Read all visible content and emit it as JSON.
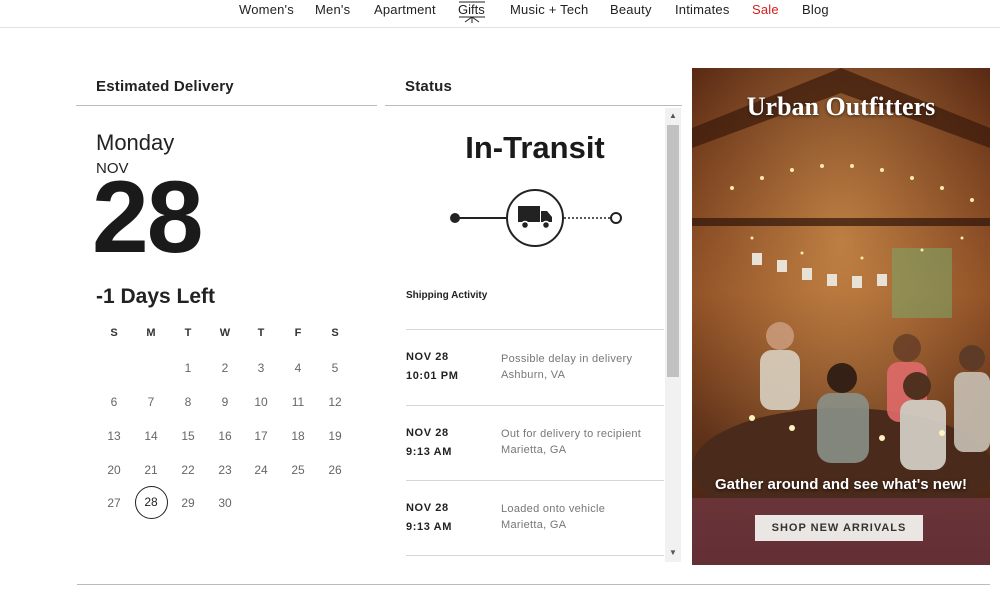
{
  "nav": {
    "items": [
      "Women's",
      "Men's",
      "Apartment",
      "Gifts",
      "Music + Tech",
      "Beauty",
      "Intimates",
      "Sale",
      "Blog"
    ],
    "sale_color": "#d51b1b"
  },
  "delivery": {
    "header": "Estimated Delivery",
    "weekday": "Monday",
    "month": "NOV",
    "day": "28",
    "days_left": "-1 Days Left",
    "calendar": {
      "weekdays": [
        "S",
        "M",
        "T",
        "W",
        "T",
        "F",
        "S"
      ],
      "rows": [
        [
          "",
          "",
          "1",
          "2",
          "3",
          "4",
          "5"
        ],
        [
          "6",
          "7",
          "8",
          "9",
          "10",
          "11",
          "12"
        ],
        [
          "13",
          "14",
          "15",
          "16",
          "17",
          "18",
          "19"
        ],
        [
          "20",
          "21",
          "22",
          "23",
          "24",
          "25",
          "26"
        ],
        [
          "27",
          "28",
          "29",
          "30",
          "",
          "",
          ""
        ]
      ],
      "selected": "28"
    }
  },
  "status": {
    "header": "Status",
    "title": "In-Transit",
    "icon": "truck-icon",
    "activity_heading": "Shipping Activity",
    "activity": [
      {
        "date": "NOV 28",
        "time": "10:01 PM",
        "desc": "Possible delay in delivery",
        "loc": "Ashburn, VA"
      },
      {
        "date": "NOV 28",
        "time": "9:13 AM",
        "desc": "Out for delivery to recipient",
        "loc": "Marietta, GA"
      },
      {
        "date": "NOV 28",
        "time": "9:13 AM",
        "desc": "Loaded onto vehicle",
        "loc": "Marietta, GA"
      }
    ]
  },
  "ad": {
    "brand": "Urban Outfitters",
    "tagline": "Gather around and see what's new!",
    "button": "SHOP NEW ARRIVALS"
  }
}
